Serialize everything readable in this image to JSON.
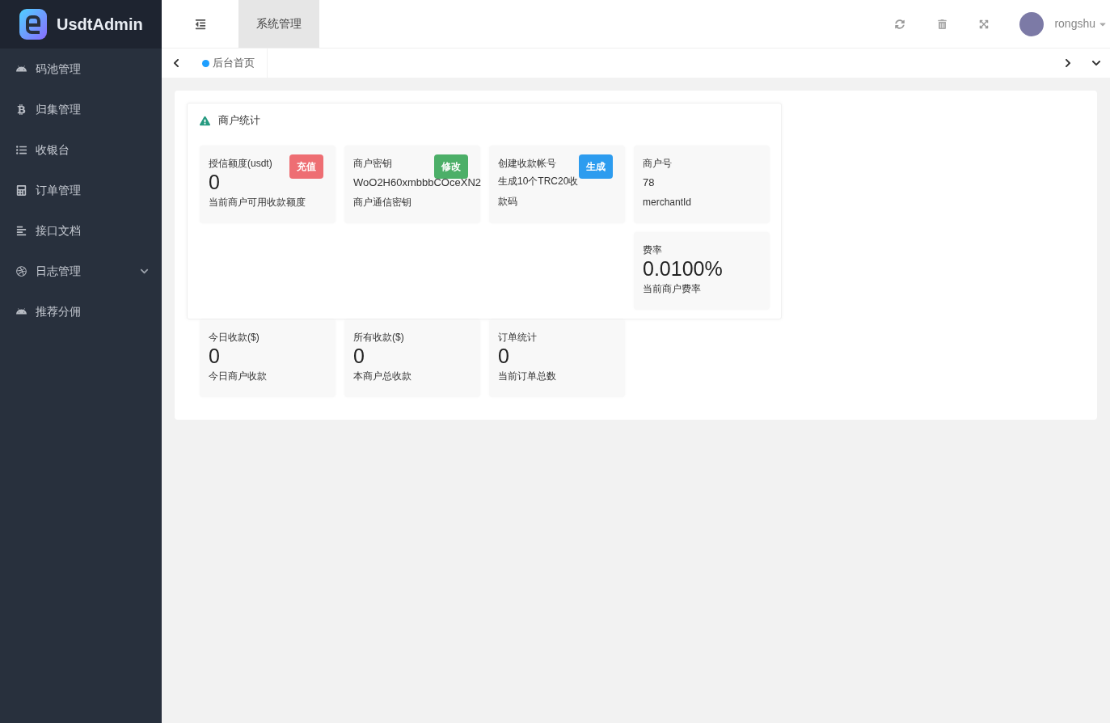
{
  "brand": {
    "name": "UsdtAdmin"
  },
  "sidebar": {
    "items": [
      {
        "label": "码池管理",
        "kind": "android",
        "expandable": false
      },
      {
        "label": "归集管理",
        "kind": "bitcoin",
        "expandable": false
      },
      {
        "label": "收银台",
        "kind": "list",
        "expandable": false
      },
      {
        "label": "订单管理",
        "kind": "calculator",
        "expandable": false
      },
      {
        "label": "接口文档",
        "kind": "align",
        "expandable": false
      },
      {
        "label": "日志管理",
        "kind": "ball",
        "expandable": true
      },
      {
        "label": "推荐分佣",
        "kind": "android",
        "expandable": false
      }
    ]
  },
  "top_tabs": [
    {
      "label": "系统管理",
      "selected": true
    }
  ],
  "user": {
    "name": "rongshu"
  },
  "page_tabs": [
    {
      "label": "后台首页",
      "selected": true
    }
  ],
  "stats_panel": {
    "title": "商户统计",
    "cards": [
      {
        "kind": "big",
        "title": "授信额度(usdt)",
        "value": "0",
        "description": "当前商户可用收款额度",
        "button": {
          "label": "充值",
          "color": "#ee6e73"
        }
      },
      {
        "kind": "info",
        "title": "商户密钥",
        "value": "WoO2H60xmbbbCOceXN2",
        "description": "商户通信密钥",
        "button": {
          "label": "修改",
          "color": "#4caf68"
        }
      },
      {
        "kind": "note",
        "title": "创建收款帐号",
        "description": "生成10个TRC20收款码",
        "button": {
          "label": "生成",
          "color": "#2d9cef"
        }
      },
      {
        "kind": "info",
        "title": "商户号",
        "value": "78",
        "description": "merchantId"
      },
      {
        "kind": "big",
        "title": "费率",
        "value": "0.0100%",
        "description": "当前商户费率"
      }
    ]
  },
  "summary_cards": [
    {
      "kind": "big",
      "title": "今日收款($)",
      "value": "0",
      "description": "今日商户收款"
    },
    {
      "kind": "big",
      "title": "所有收款($)",
      "value": "0",
      "description": "本商户总收款"
    },
    {
      "kind": "big",
      "title": "订单统计",
      "value": "0",
      "description": "当前订单总数"
    }
  ]
}
